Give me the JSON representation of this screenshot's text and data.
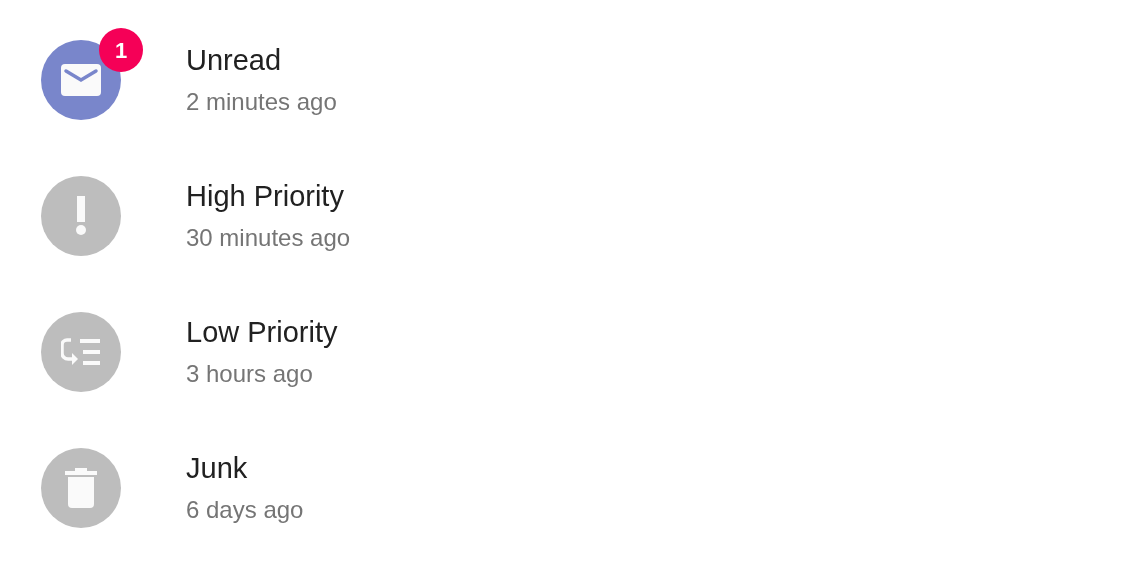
{
  "items": [
    {
      "kind": "mail",
      "color": "#7986cb",
      "title": "Unread",
      "subtitle": "2 minutes ago",
      "badge": "1"
    },
    {
      "kind": "alert",
      "color": "#bdbdbd",
      "title": "High Priority",
      "subtitle": "30 minutes ago"
    },
    {
      "kind": "low-priority",
      "color": "#bdbdbd",
      "title": "Low Priority",
      "subtitle": "3 hours ago"
    },
    {
      "kind": "trash",
      "color": "#bdbdbd",
      "title": "Junk",
      "subtitle": "6 days ago"
    }
  ]
}
